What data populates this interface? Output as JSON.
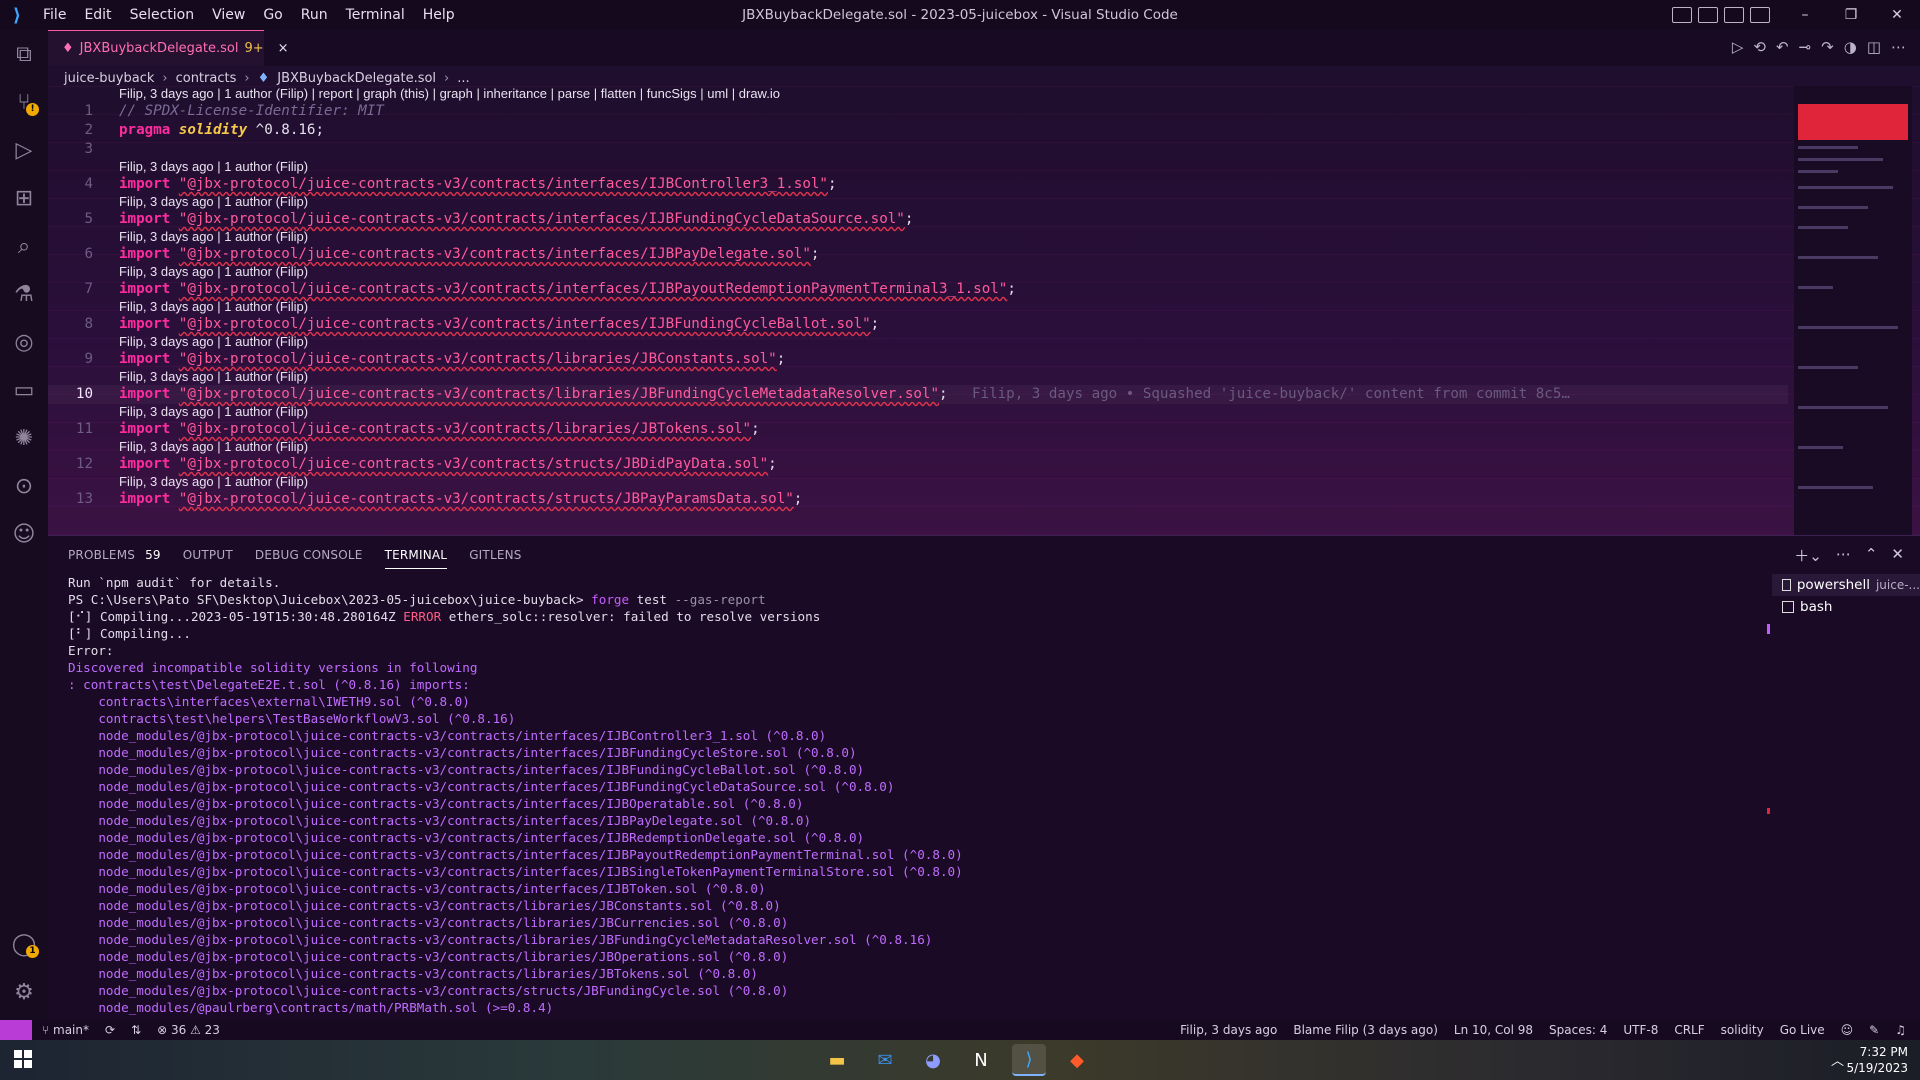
{
  "titlebar": {
    "menu": [
      "File",
      "Edit",
      "Selection",
      "View",
      "Go",
      "Run",
      "Terminal",
      "Help"
    ],
    "title": "JBXBuybackDelegate.sol - 2023-05-juicebox - Visual Studio Code"
  },
  "tab": {
    "name": "JBXBuybackDelegate.sol",
    "problems": "9+",
    "close": "×"
  },
  "breadcrumb": [
    "juice-buyback",
    "contracts",
    "JBXBuybackDelegate.sol",
    "..."
  ],
  "codelens_top": "Filip, 3 days ago | 1 author (Filip) | report | graph (this) | graph | inheritance | parse | flatten | funcSigs | uml | draw.io",
  "blame_lens": "Filip, 3 days ago | 1 author (Filip)",
  "code": {
    "l1": "// SPDX-License-Identifier: MIT",
    "l2_kw": "pragma",
    "l2_sol": "solidity",
    "l2_ver": " ^0.8.16;",
    "import_kw": "import",
    "semi": ";",
    "imports": [
      "\"@jbx-protocol/juice-contracts-v3/contracts/interfaces/IJBController3_1.sol\"",
      "\"@jbx-protocol/juice-contracts-v3/contracts/interfaces/IJBFundingCycleDataSource.sol\"",
      "\"@jbx-protocol/juice-contracts-v3/contracts/interfaces/IJBPayDelegate.sol\"",
      "\"@jbx-protocol/juice-contracts-v3/contracts/interfaces/IJBPayoutRedemptionPaymentTerminal3_1.sol\"",
      "\"@jbx-protocol/juice-contracts-v3/contracts/interfaces/IJBFundingCycleBallot.sol\"",
      "\"@jbx-protocol/juice-contracts-v3/contracts/libraries/JBConstants.sol\"",
      "\"@jbx-protocol/juice-contracts-v3/contracts/libraries/JBFundingCycleMetadataResolver.sol\"",
      "\"@jbx-protocol/juice-contracts-v3/contracts/libraries/JBTokens.sol\"",
      "\"@jbx-protocol/juice-contracts-v3/contracts/structs/JBDidPayData.sol\"",
      "\"@jbx-protocol/juice-contracts-v3/contracts/structs/JBPayParamsData.sol\""
    ],
    "inline_blame": "Filip, 3 days ago • Squashed 'juice-buyback/' content from commit 8c5…"
  },
  "panel": {
    "tabs": {
      "problems": "PROBLEMS",
      "problems_count": "59",
      "output": "OUTPUT",
      "debug": "DEBUG CONSOLE",
      "terminal": "TERMINAL",
      "gitlens": "GITLENS"
    },
    "terminals": [
      {
        "name": "powershell",
        "sub": "juice-..."
      },
      {
        "name": "bash",
        "sub": ""
      }
    ],
    "lines": {
      "t0": "Run `npm audit` for details.",
      "t1a": "PS C:\\Users\\Pato SF\\Desktop\\Juicebox\\2023-05-juicebox\\juice-buyback> ",
      "t1b": "forge",
      "t1c": " test ",
      "t1d": "--gas-report",
      "t2a": "[⠊] Compiling...2023-05-19T15:30:48.280164Z ",
      "t2b": "ERROR",
      "t2c": " ethers_solc::resolver: failed to resolve versions",
      "t3": "[⠃] Compiling...",
      "t4": "Error:",
      "t5": "Discovered incompatible solidity versions in following",
      "t6": ": contracts\\test\\DelegateE2E.t.sol (^0.8.16) imports:",
      "t7": "    contracts\\interfaces\\external\\IWETH9.sol (^0.8.0)",
      "t8": "    contracts\\test\\helpers\\TestBaseWorkflowV3.sol (^0.8.16)",
      "t9": "    node_modules/@jbx-protocol\\juice-contracts-v3/contracts/interfaces/IJBController3_1.sol (^0.8.0)",
      "t10": "    node_modules/@jbx-protocol\\juice-contracts-v3/contracts/interfaces/IJBFundingCycleStore.sol (^0.8.0)",
      "t11": "    node_modules/@jbx-protocol\\juice-contracts-v3/contracts/interfaces/IJBFundingCycleBallot.sol (^0.8.0)",
      "t12": "    node_modules/@jbx-protocol\\juice-contracts-v3/contracts/interfaces/IJBFundingCycleDataSource.sol (^0.8.0)",
      "t13": "    node_modules/@jbx-protocol\\juice-contracts-v3/contracts/interfaces/IJBOperatable.sol (^0.8.0)",
      "t14": "    node_modules/@jbx-protocol\\juice-contracts-v3/contracts/interfaces/IJBPayDelegate.sol (^0.8.0)",
      "t15": "    node_modules/@jbx-protocol\\juice-contracts-v3/contracts/interfaces/IJBRedemptionDelegate.sol (^0.8.0)",
      "t16": "    node_modules/@jbx-protocol\\juice-contracts-v3/contracts/interfaces/IJBPayoutRedemptionPaymentTerminal.sol (^0.8.0)",
      "t17": "    node_modules/@jbx-protocol\\juice-contracts-v3/contracts/interfaces/IJBSingleTokenPaymentTerminalStore.sol (^0.8.0)",
      "t18": "    node_modules/@jbx-protocol\\juice-contracts-v3/contracts/interfaces/IJBToken.sol (^0.8.0)",
      "t19": "    node_modules/@jbx-protocol\\juice-contracts-v3/contracts/libraries/JBConstants.sol (^0.8.0)",
      "t20": "    node_modules/@jbx-protocol\\juice-contracts-v3/contracts/libraries/JBCurrencies.sol (^0.8.0)",
      "t21": "    node_modules/@jbx-protocol\\juice-contracts-v3/contracts/libraries/JBFundingCycleMetadataResolver.sol (^0.8.16)",
      "t22": "    node_modules/@jbx-protocol\\juice-contracts-v3/contracts/libraries/JBOperations.sol (^0.8.0)",
      "t23": "    node_modules/@jbx-protocol\\juice-contracts-v3/contracts/libraries/JBTokens.sol (^0.8.0)",
      "t24": "    node_modules/@jbx-protocol\\juice-contracts-v3/contracts/structs/JBFundingCycle.sol (^0.8.0)",
      "t25": "    node_modules/@paulrberg\\contracts/math/PRBMath.sol (>=0.8.4)"
    }
  },
  "status": {
    "branch": "main*",
    "errors": "⊗ 36 ⚠ 23",
    "blame": "Filip, 3 days ago",
    "blame2": "Blame Filip (3 days ago)",
    "pos": "Ln 10, Col 98",
    "spaces": "Spaces: 4",
    "enc": "UTF-8",
    "eol": "CRLF",
    "lang": "solidity",
    "golive": "Go Live"
  },
  "taskbar": {
    "time": "7:32 PM",
    "date": "5/19/2023"
  },
  "colors": {
    "accent": "#ff2c9f",
    "string": "#ff5a9c",
    "keyword_solidity": "#f7c948",
    "badge": "#f2a900",
    "remote": "#b93cd6"
  }
}
